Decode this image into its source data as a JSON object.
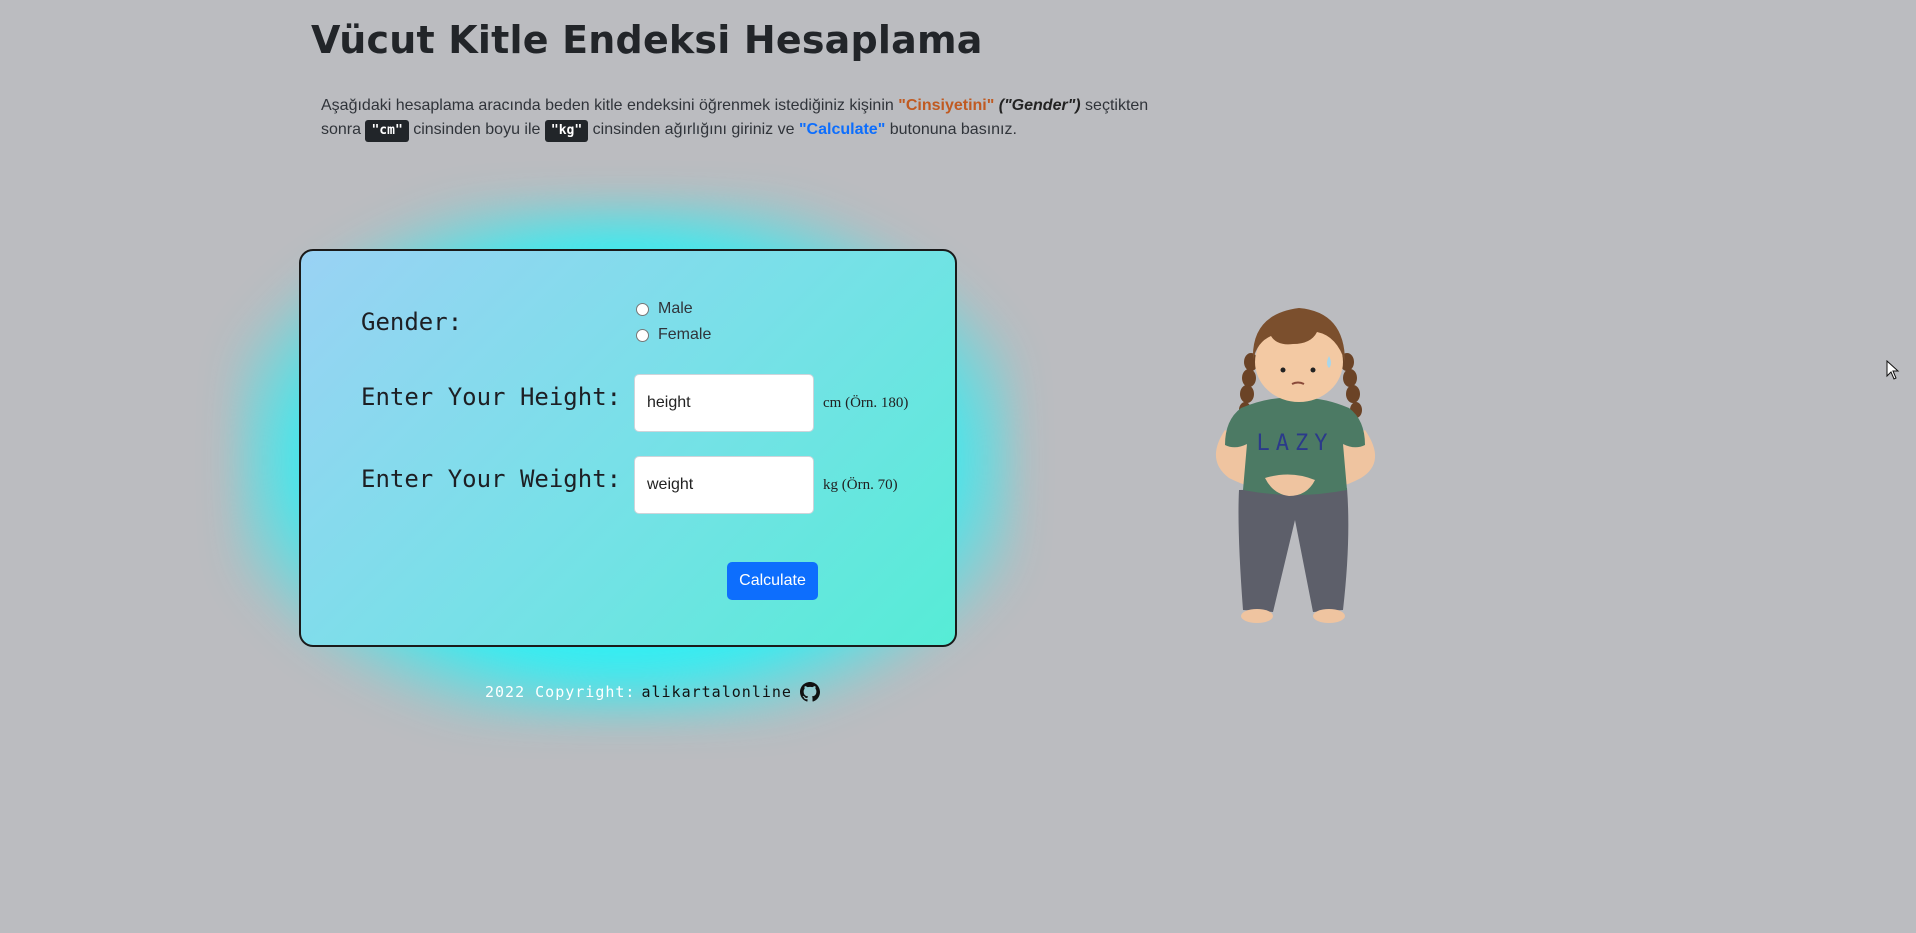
{
  "page": {
    "title": "Vücut Kitle Endeksi Hesaplama"
  },
  "intro": {
    "part1": "Aşağıdaki hesaplama aracında beden kitle endeksini öğrenmek istediğiniz kişinin ",
    "gender_tr": "\"Cinsiyetini\"",
    "gender_en": " (\"Gender\")",
    "part2": " seçtikten sonra ",
    "cm_code": "\"cm\"",
    "part3": " cinsinden boyu ile ",
    "kg_code": "\"kg\"",
    "part4": " cinsinden ağırlığını giriniz ve ",
    "calculate_ref": "\"Calculate\"",
    "part5": " butonuna basınız."
  },
  "form": {
    "gender_label": "Gender:",
    "gender_options": [
      {
        "label": "Male",
        "selected": false
      },
      {
        "label": "Female",
        "selected": false
      }
    ],
    "height_label": "Enter Your Height:",
    "height_placeholder": "height",
    "height_unit": "cm (Örn. 180)",
    "weight_label": "Enter Your Weight:",
    "weight_placeholder": "weight",
    "weight_unit": "kg (Örn. 70)",
    "calculate_label": "Calculate"
  },
  "footer": {
    "copyright": "2022 Copyright:",
    "author": "alikartalonline",
    "icon": "github-icon"
  },
  "illustration": {
    "shirt_text": "LAZY"
  },
  "colors": {
    "background": "#bbbcc0",
    "accent_blue": "#0d6efd",
    "accent_orange": "#c05a21",
    "glow": "#1affff"
  }
}
